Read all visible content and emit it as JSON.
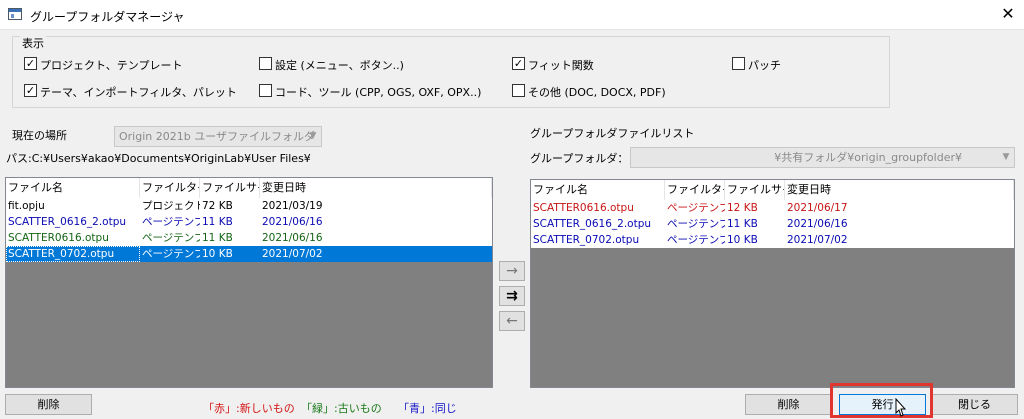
{
  "window": {
    "title": "グループフォルダマネージャ",
    "close_glyph": "✕"
  },
  "display_group": {
    "label": "表示",
    "options": [
      {
        "label": "プロジェクト、テンプレート",
        "checked": true
      },
      {
        "label": "設定 (メニュー、ボタン..)",
        "checked": false
      },
      {
        "label": "フィット関数",
        "checked": true
      },
      {
        "label": "パッチ",
        "checked": false
      },
      {
        "label": "テーマ、インポートフィルタ、パレット",
        "checked": true
      },
      {
        "label": "コード、ツール (CPP, OGS, OXF, OPX..)",
        "checked": false
      },
      {
        "label": "その他 (DOC, DOCX, PDF)",
        "checked": false
      }
    ]
  },
  "left_panel": {
    "location_label": "現在の場所",
    "location_value": "Origin 2021b ユーザファイルフォルダ",
    "path_text": "パス:C:¥Users¥akao¥Documents¥OriginLab¥User Files¥",
    "columns": [
      "ファイル名",
      "ファイルタイプ",
      "ファイルサイズ",
      "変更日時"
    ],
    "rows": [
      {
        "name": "fit.opju",
        "type": "プロジェクトファイル",
        "size": "72 KB",
        "date": "2021/03/19",
        "color": "#000000",
        "selected": false
      },
      {
        "name": "SCATTER_0616_2.otpu",
        "type": "ページテンプレート",
        "size": "11 KB",
        "date": "2021/06/16",
        "color": "#0a0ab4",
        "selected": false
      },
      {
        "name": "SCATTER0616.otpu",
        "type": "ページテンプレート",
        "size": "11 KB",
        "date": "2021/06/16",
        "color": "#146414",
        "selected": false
      },
      {
        "name": "SCATTER_0702.otpu",
        "type": "ページテンプレート",
        "size": "10 KB",
        "date": "2021/07/02",
        "color": "#ffffff",
        "selected": true
      }
    ],
    "delete_label": "削除"
  },
  "transfer": {
    "right_glyph": "→",
    "both_glyph": "⇉",
    "left_glyph": "←"
  },
  "right_panel": {
    "list_title": "グループフォルダファイルリスト",
    "folder_label": "グループフォルダ：",
    "folder_value": "¥共有フォルダ¥origin_groupfolder¥",
    "columns": [
      "ファイル名",
      "ファイルタイプ",
      "ファイルサイズ",
      "変更日時"
    ],
    "rows": [
      {
        "name": "SCATTER0616.otpu",
        "type": "ページテンプレート",
        "size": "12 KB",
        "date": "2021/06/17",
        "color": "#c81414"
      },
      {
        "name": "SCATTER_0616_2.otpu",
        "type": "ページテンプレート",
        "size": "11 KB",
        "date": "2021/06/16",
        "color": "#0a0ab4"
      },
      {
        "name": "SCATTER_0702.otpu",
        "type": "ページテンプレート",
        "size": "10 KB",
        "date": "2021/07/02",
        "color": "#0a0ab4"
      }
    ],
    "delete_label": "削除",
    "publish_label": "発行",
    "close_label": "閉じる"
  },
  "legend": {
    "red": "「赤」:新しいもの",
    "green": "「緑」:古いもの",
    "blue": "「青」:同じ"
  },
  "colors": {
    "red": "#d41414",
    "green": "#1a7a1a",
    "blue": "#1414c8",
    "highlight": "#e0362f",
    "selection": "#0078d7"
  }
}
